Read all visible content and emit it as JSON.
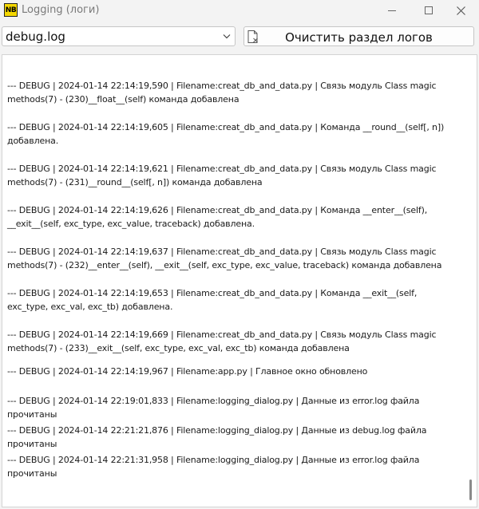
{
  "window": {
    "app_badge": "NB",
    "title": "Logging (логи)"
  },
  "toolbar": {
    "log_select_value": "debug.log",
    "clear_button_label": "Очистить раздел логов"
  },
  "log": {
    "entries": [
      "--- DEBUG | 2024-01-14 22:14:19,590 | Filename:creat_db_and_data.py | Связь модуль Class magic methods(7) - (230)__float__(self) команда добавлена",
      "--- DEBUG | 2024-01-14 22:14:19,605 | Filename:creat_db_and_data.py | Команда __round__(self[, n]) добавлена.",
      "--- DEBUG | 2024-01-14 22:14:19,621 | Filename:creat_db_and_data.py | Связь модуль Class magic methods(7) - (231)__round__(self[, n]) команда добавлена",
      "--- DEBUG | 2024-01-14 22:14:19,626 | Filename:creat_db_and_data.py | Команда __enter__(self), __exit__(self, exc_type, exc_value, traceback) добавлена.",
      "--- DEBUG | 2024-01-14 22:14:19,637 | Filename:creat_db_and_data.py | Связь модуль Class magic methods(7) - (232)__enter__(self), __exit__(self, exc_type, exc_value, traceback) команда добавлена",
      "--- DEBUG | 2024-01-14 22:14:19,653 | Filename:creat_db_and_data.py | Команда __exit__(self, exc_type, exc_val, exc_tb) добавлена.",
      "--- DEBUG | 2024-01-14 22:14:19,669 | Filename:creat_db_and_data.py | Связь модуль Class magic methods(7) - (233)__exit__(self, exc_type, exc_val, exc_tb) команда добавлена",
      "--- DEBUG | 2024-01-14 22:14:19,967 | Filename:app.py | Главное окно обновлено",
      "--- DEBUG | 2024-01-14 22:19:01,833 | Filename:logging_dialog.py | Данные из error.log файла прочитаны",
      "--- DEBUG | 2024-01-14 22:21:21,876 | Filename:logging_dialog.py | Данные из debug.log файла прочитаны",
      "--- DEBUG | 2024-01-14 22:21:31,958 | Filename:logging_dialog.py | Данные из error.log файла прочитаны"
    ]
  },
  "icons": {
    "app": "nb-logo-icon",
    "minimize": "minimize-icon",
    "maximize": "maximize-icon",
    "close": "close-icon",
    "dropdown": "chevron-down-icon",
    "clear": "clear-document-icon"
  }
}
